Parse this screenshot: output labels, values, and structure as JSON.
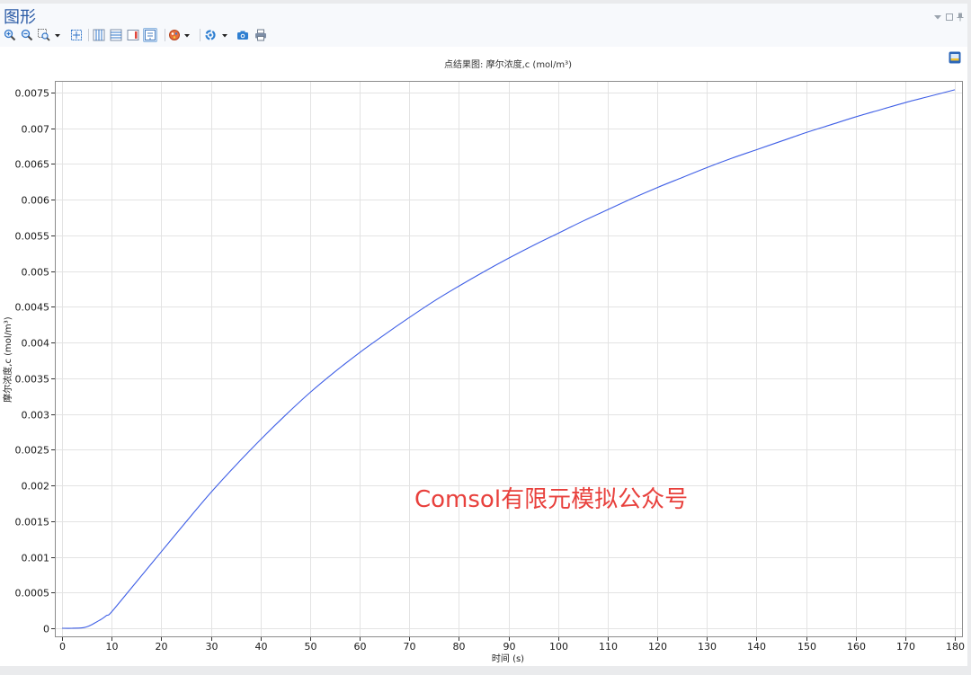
{
  "window": {
    "title": "图形",
    "controls": [
      "collapse-icon",
      "maximize-icon",
      "pin-icon"
    ]
  },
  "toolbar": {
    "icons": [
      "zoom-in-icon",
      "zoom-out-icon",
      "zoom-box-icon",
      "chevron-down-icon",
      "zoom-extents-icon",
      "vertical-grid-lines-icon",
      "horizontal-grid-lines-icon",
      "legend-icon",
      "text-box-icon",
      "palette-icon",
      "chevron-down-icon",
      "circular-arrows-icon",
      "chevron-down-icon",
      "camera-icon",
      "printer-icon"
    ],
    "selected": "text-box-icon"
  },
  "plot": {
    "corner_icon": "plot-icon",
    "watermark": "Comsol有限元模拟公众号"
  },
  "colors": {
    "title": "#2b5ba6",
    "curve": "#3f5fe6",
    "grid": "#e3e3e3",
    "frame": "#8c8c8c",
    "watermark": "#e8403c",
    "selected_tool_bg": "#d8e8f8"
  },
  "chart_data": {
    "type": "line",
    "title": "点结果图: 摩尔浓度,c (mol/m³)",
    "xlabel": "时间 (s)",
    "ylabel": "摩尔浓度,c (mol/m³)",
    "xlim": [
      -1.45,
      181.63
    ],
    "ylim": [
      -0.000126,
      0.007664
    ],
    "xticks": [
      "0",
      "10",
      "20",
      "30",
      "40",
      "50",
      "60",
      "70",
      "80",
      "90",
      "100",
      "110",
      "120",
      "130",
      "140",
      "150",
      "160",
      "170",
      "180"
    ],
    "yticks": [
      "0",
      "0.0005",
      "0.001",
      "0.0015",
      "0.002",
      "0.0025",
      "0.003",
      "0.0035",
      "0.004",
      "0.0045",
      "0.005",
      "0.0055",
      "0.006",
      "0.0065",
      "0.007",
      "0.0075"
    ],
    "grid": true,
    "legend": "none",
    "series": [
      {
        "x": [
          0,
          2,
          4,
          5,
          6,
          7,
          8,
          9,
          10,
          15,
          20,
          25,
          30,
          35,
          40,
          45,
          50,
          55,
          60,
          65,
          70,
          75,
          80,
          85,
          90,
          95,
          100,
          105,
          110,
          115,
          120,
          125,
          130,
          135,
          140,
          145,
          150,
          155,
          160,
          165,
          170,
          175,
          180
        ],
        "y": [
          0,
          0,
          5e-06,
          2e-05,
          5e-05,
          9e-05,
          0.00013,
          0.00018,
          0.00023,
          0.00065,
          0.00107,
          0.00149,
          0.0019,
          0.00228,
          0.00264,
          0.00298,
          0.0033,
          0.00359,
          0.00386,
          0.00411,
          0.00435,
          0.00458,
          0.00479,
          0.00499,
          0.00518,
          0.00536,
          0.00553,
          0.0057,
          0.00586,
          0.00602,
          0.00617,
          0.00631,
          0.00645,
          0.00658,
          0.0067,
          0.00682,
          0.00694,
          0.00705,
          0.00716,
          0.00726,
          0.00736,
          0.00745,
          0.00754
        ]
      }
    ]
  }
}
